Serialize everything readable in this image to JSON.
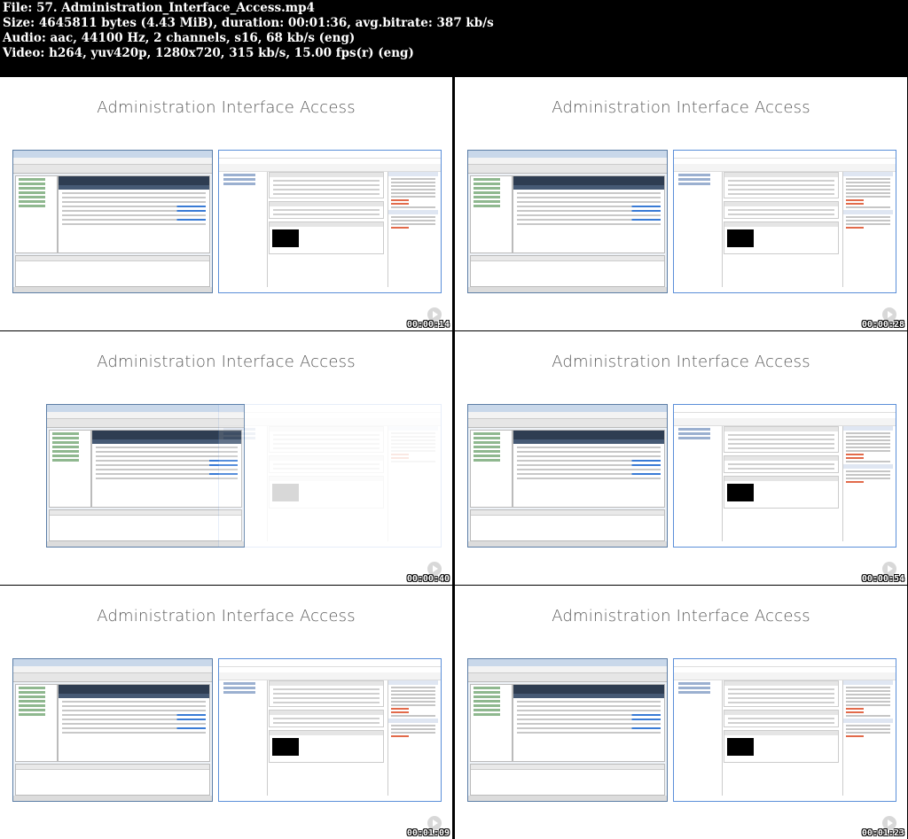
{
  "header": {
    "line1": "File: 57. Administration_Interface_Access.mp4",
    "line2": "Size: 4645811 bytes (4.43 MiB), duration: 00:01:36, avg.bitrate: 387 kb/s",
    "line3": "Audio: aac, 44100 Hz, 2 channels, s16, 68 kb/s (eng)",
    "line4": "Video: h264, yuv420p, 1280x720, 315 kb/s, 15.00 fps(r) (eng)"
  },
  "thumbnails": [
    {
      "title": "Administration Interface Access",
      "timestamp": "00:00:14"
    },
    {
      "title": "Administration Interface Access",
      "timestamp": "00:00:28"
    },
    {
      "title": "Administration Interface Access",
      "timestamp": "00:00:40"
    },
    {
      "title": "Administration Interface Access",
      "timestamp": "00:00:54"
    },
    {
      "title": "Administration Interface Access",
      "timestamp": "00:01:09"
    },
    {
      "title": "Administration Interface Access",
      "timestamp": "00:01:23"
    }
  ]
}
